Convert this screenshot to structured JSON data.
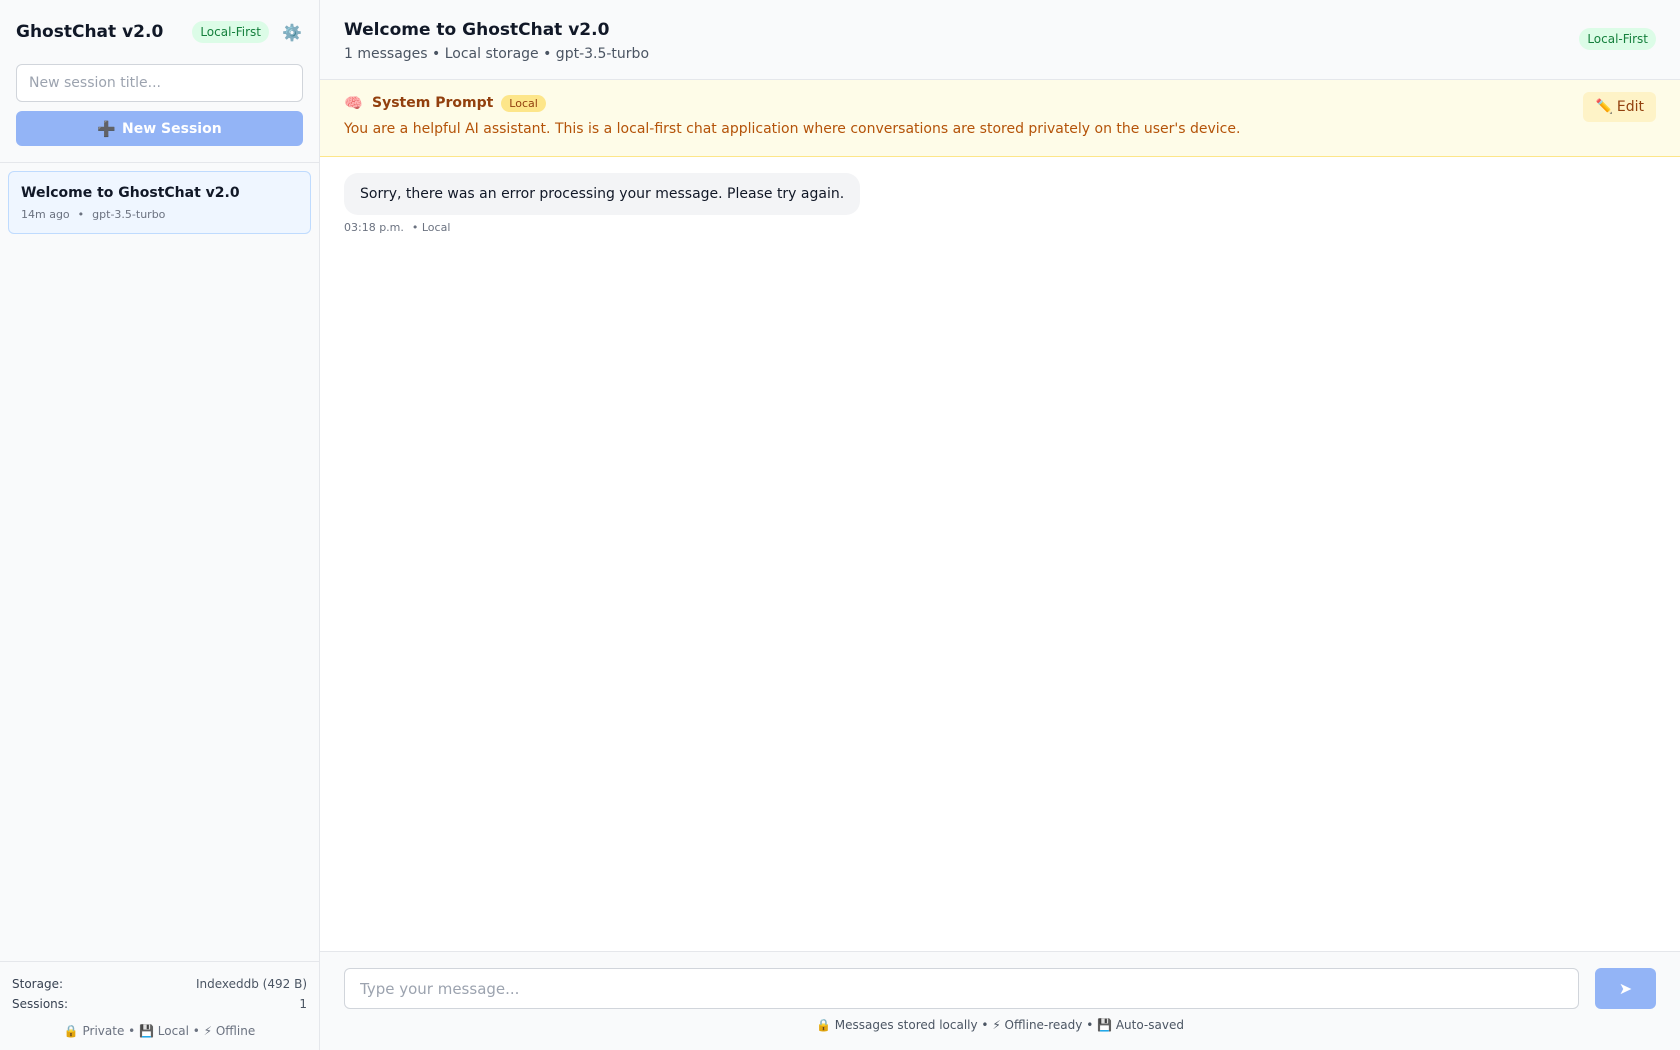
{
  "sidebar": {
    "app_title": "GhostChat v2.0",
    "badge": "Local-First",
    "settings_icon": "⚙️",
    "session_input_placeholder": "New session title...",
    "new_session_icon": "➕",
    "new_session_label": "New Session",
    "sessions": [
      {
        "title": "Welcome to GhostChat v2.0",
        "time": "14m ago",
        "separator": "•",
        "model": "gpt-3.5-turbo"
      }
    ],
    "footer": {
      "storage_label": "Storage:",
      "storage_value": "Indexeddb (492 B)",
      "sessions_label": "Sessions:",
      "sessions_value": "1",
      "features": "🔒 Private • 💾 Local • ⚡ Offline"
    }
  },
  "main": {
    "title": "Welcome to GhostChat v2.0",
    "meta": "1 messages • Local storage • gpt-3.5-turbo",
    "badge": "Local-First",
    "system_prompt": {
      "icon": "🧠",
      "label": "System Prompt",
      "badge": "Local",
      "text": "You are a helpful AI assistant. This is a local-first chat application where conversations are stored privately on the user's device.",
      "edit_icon": "✏️",
      "edit_label": "Edit"
    },
    "messages": [
      {
        "text": "Sorry, there was an error processing your message. Please try again.",
        "time": "03:18 p.m.",
        "tag": "• Local"
      }
    ],
    "composer": {
      "placeholder": "Type your message...",
      "send_icon": "➤",
      "footer": "🔒 Messages stored locally • ⚡ Offline-ready • 💾 Auto-saved"
    }
  },
  "colors": {
    "accent": "#93b4f6",
    "local_badge_bg": "#dcfce7",
    "local_badge_text": "#15803d",
    "system_prompt_bg": "#fefce8",
    "system_prompt_text": "#b45309"
  }
}
